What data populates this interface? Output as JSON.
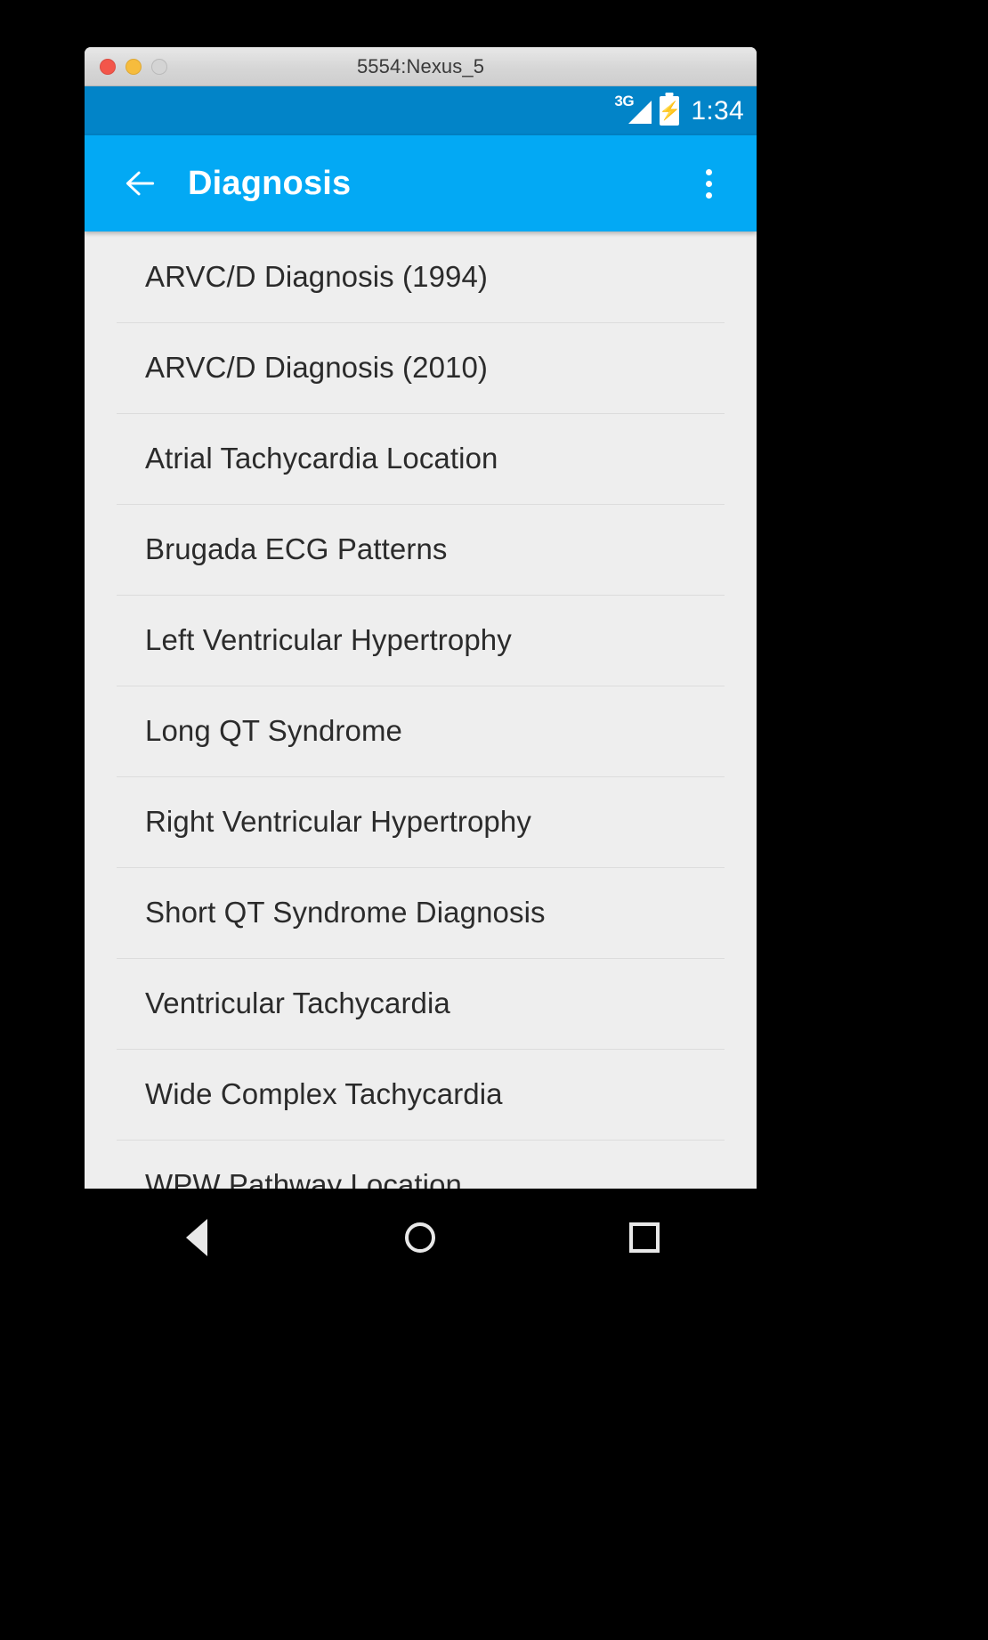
{
  "window": {
    "title": "5554:Nexus_5",
    "controls": [
      {
        "name": "close",
        "color": "#f3564a"
      },
      {
        "name": "minimize",
        "color": "#f6bc3d"
      },
      {
        "name": "zoom",
        "color": "#d4d4d4"
      }
    ]
  },
  "status_bar": {
    "network_type": "3G",
    "battery_state": "charging",
    "time": "1:34",
    "background": "#0284c8"
  },
  "app_bar": {
    "title": "Diagnosis",
    "back_icon": "arrow-left-icon",
    "overflow_icon": "more-vertical-icon",
    "background": "#03a9f4"
  },
  "list": {
    "background": "#eeeeee",
    "divider_color": "#dcdcdc",
    "items": [
      {
        "label": "ARVC/D Diagnosis (1994)"
      },
      {
        "label": "ARVC/D Diagnosis (2010)"
      },
      {
        "label": "Atrial Tachycardia Location"
      },
      {
        "label": "Brugada ECG Patterns"
      },
      {
        "label": "Left Ventricular Hypertrophy"
      },
      {
        "label": "Long QT Syndrome"
      },
      {
        "label": "Right Ventricular Hypertrophy"
      },
      {
        "label": "Short QT Syndrome Diagnosis"
      },
      {
        "label": "Ventricular Tachycardia"
      },
      {
        "label": "Wide Complex Tachycardia"
      },
      {
        "label": "WPW Pathway Location"
      }
    ]
  },
  "nav_bar": {
    "back_label": "Back",
    "home_label": "Home",
    "recents_label": "Recents"
  }
}
